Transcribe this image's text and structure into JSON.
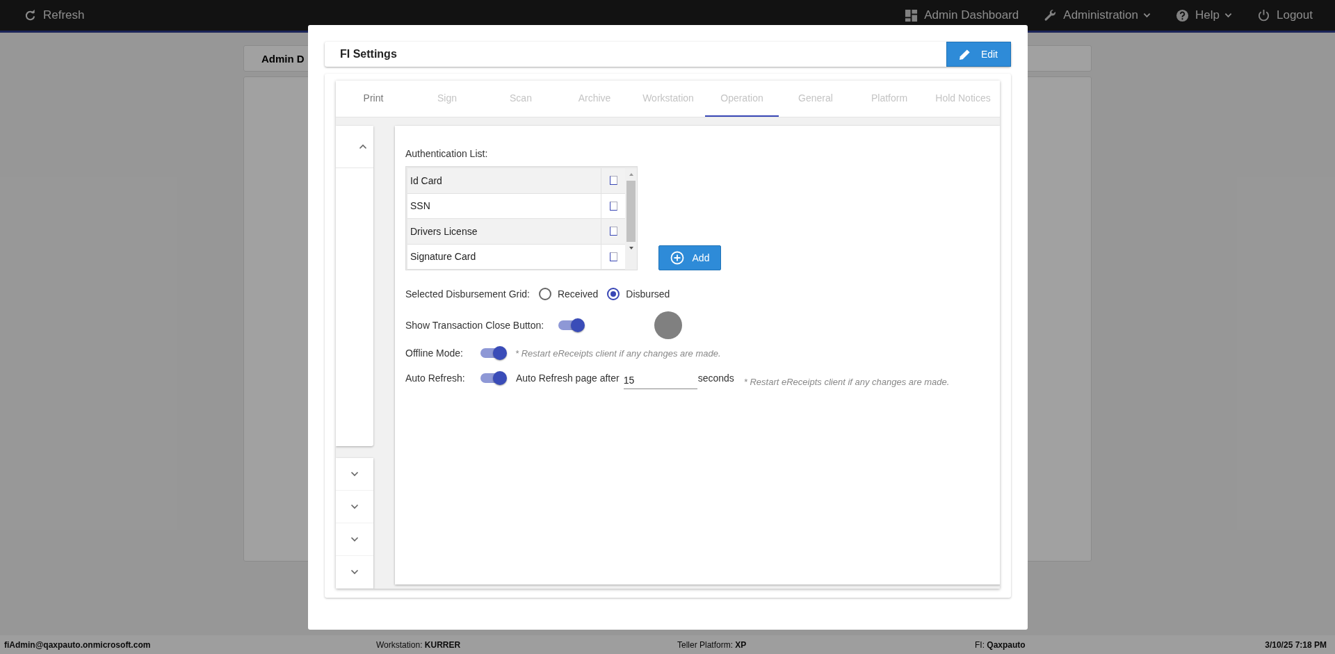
{
  "top_bar": {
    "refresh": "Refresh",
    "nav": [
      {
        "kind": "dashboard",
        "label": "Admin Dashboard",
        "dropdown": false
      },
      {
        "kind": "wrench",
        "label": "Administration",
        "dropdown": true
      },
      {
        "kind": "help",
        "label": "Help",
        "dropdown": true
      },
      {
        "kind": "power",
        "label": "Logout",
        "dropdown": false
      }
    ]
  },
  "background_page": {
    "tab": "Admin D"
  },
  "modal": {
    "title": "FI Settings",
    "edit_button": "Edit",
    "tabs": [
      {
        "label": "Print",
        "selected": false,
        "disabled": false
      },
      {
        "label": "Sign",
        "selected": false,
        "disabled": true
      },
      {
        "label": "Scan",
        "selected": false,
        "disabled": true
      },
      {
        "label": "Archive",
        "selected": false,
        "disabled": true
      },
      {
        "label": "Workstation",
        "selected": false,
        "disabled": true
      },
      {
        "label": "Operation",
        "selected": true,
        "disabled": true
      },
      {
        "label": "General",
        "selected": false,
        "disabled": true
      },
      {
        "label": "Platform",
        "selected": false,
        "disabled": true
      },
      {
        "label": "Hold Notices",
        "selected": false,
        "disabled": true
      }
    ],
    "side_chevrons": [
      {
        "kind": "up"
      },
      {
        "kind": "down"
      },
      {
        "kind": "down"
      },
      {
        "kind": "down"
      },
      {
        "kind": "down"
      }
    ],
    "authentication_list": {
      "label": "Authentication List:",
      "rows": [
        {
          "name": "Id Card",
          "checked": false
        },
        {
          "name": "SSN",
          "checked": false
        },
        {
          "name": "Drivers License",
          "checked": false
        },
        {
          "name": "Signature Card",
          "checked": false
        }
      ]
    },
    "add_button": "Add",
    "disbursement_grid": {
      "label": "Selected Disbursement Grid:",
      "options": [
        {
          "label": "Received",
          "selected": false
        },
        {
          "label": "Disbursed",
          "selected": true
        }
      ]
    },
    "show_transaction_close": {
      "label": "Show Transaction Close Button:",
      "on": true
    },
    "offline_mode": {
      "label": "Offline Mode:",
      "on": true,
      "note": "* Restart eReceipts client if any changes are made."
    },
    "auto_refresh": {
      "label": "Auto Refresh:",
      "on": true,
      "prefix": "Auto Refresh page after",
      "value": "15",
      "suffix": "seconds",
      "note": "* Restart eReceipts client if any changes are made."
    }
  },
  "status_bar": {
    "user": "fiAdmin@qaxpauto.onmicrosoft.com",
    "workstation": "Workstation: **KURRER**",
    "platform": "Teller Platform: **XP**",
    "fi": "FI: **Qaxpauto**",
    "datetime": "3/10/25 7:18 PM"
  }
}
